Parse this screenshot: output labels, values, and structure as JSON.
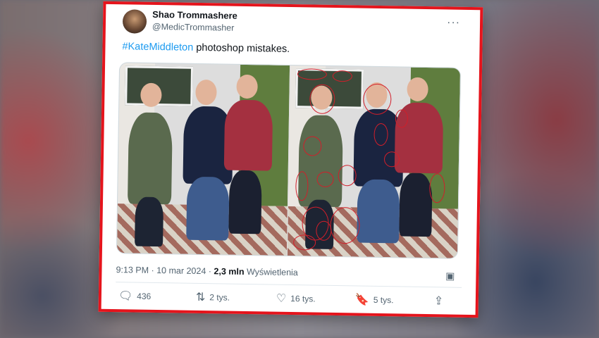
{
  "tweet": {
    "display_name": "Shao Trommashere",
    "handle": "@MedicTrommasher",
    "more_icon": "more-dots-icon",
    "hashtag": "#KateMiddleton",
    "text_rest": " photoshop mistakes.",
    "meta": {
      "time": "9:13 PM",
      "separator": " · ",
      "date": "10 mar 2024",
      "dot": " · ",
      "views_count": "2,3 mln",
      "views_label": " Wyświetlenia"
    },
    "actions": [
      {
        "icon": "reply-icon",
        "glyph": "🗨",
        "count": "436"
      },
      {
        "icon": "retweet-icon",
        "glyph": "⇅",
        "count": "2 tys."
      },
      {
        "icon": "like-icon",
        "glyph": "♡",
        "count": "16 tys."
      },
      {
        "icon": "bookmark-icon",
        "glyph": "🔖",
        "count": "5 tys."
      },
      {
        "icon": "share-icon",
        "glyph": "⇪",
        "count": ""
      }
    ]
  },
  "colors": {
    "frame_red": "#e5141c",
    "hashtag_blue": "#1d9bf0",
    "annotation_red": "#d21e2a"
  }
}
